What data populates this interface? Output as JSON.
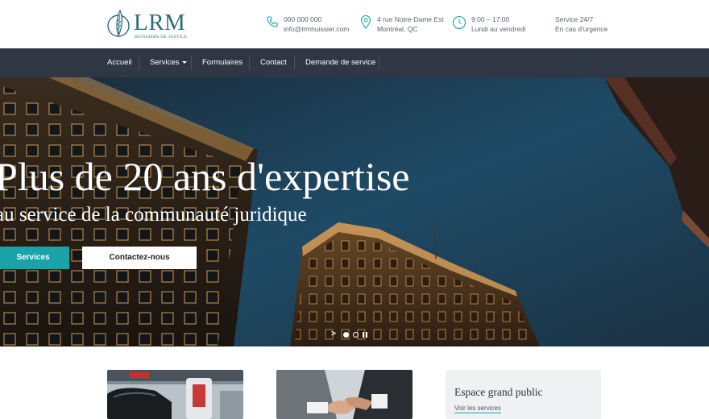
{
  "header": {
    "logo": {
      "name": "LRM",
      "subtitle": "HUISSIERS DE JUSTICE"
    },
    "phone": {
      "line1": "000 000 000",
      "line2": "info@lrmhuissier.com",
      "icon": "phone-icon"
    },
    "address": {
      "line1": "4 rue Notre-Dame Est",
      "line2": "Montréal, QC",
      "icon": "map-pin-icon"
    },
    "hours": {
      "line1": "9:00 – 17:00",
      "line2": "Lundi au vendredi",
      "icon": "clock-icon"
    },
    "service": {
      "line1": "Service 24/7",
      "line2": "En cas d'urgence"
    }
  },
  "nav": {
    "items": [
      {
        "label": "Accueil"
      },
      {
        "label": "Services"
      },
      {
        "label": "Formulaires"
      },
      {
        "label": "Contact"
      },
      {
        "label": "Demande de service"
      }
    ]
  },
  "hero": {
    "title": "Plus de 20 ans d'expertise",
    "subtitle": "au service de la communauté juridique",
    "btn_primary": "Services",
    "btn_secondary": "Contactez-nous",
    "slides_total": 2,
    "active_slide": 1
  },
  "cards": [
    {
      "image": "car-charging-photo"
    },
    {
      "image": "handshake-photo"
    },
    {
      "title": "Espace grand public",
      "link": "Voir les services"
    }
  ],
  "colors": {
    "accent": "#1aa3a8",
    "nav_bg": "#2f3745",
    "logo": "#2b6b7a"
  }
}
